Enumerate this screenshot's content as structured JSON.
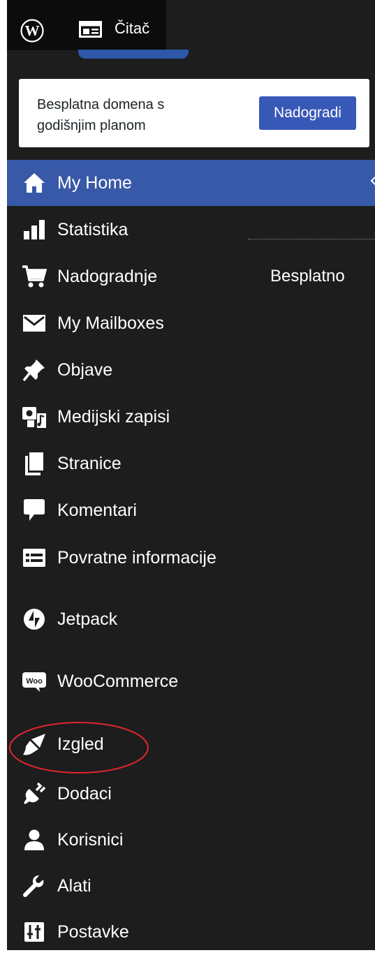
{
  "admin_bar": {
    "logo_icon": "wordpress-logo-icon",
    "reader_icon": "reader-icon",
    "reader_label": "Čitač"
  },
  "upgrade_card": {
    "text": "Besplatna domena s godišnjim planom",
    "button_label": "Nadogradi"
  },
  "menu": {
    "items": [
      {
        "label": "My Home",
        "icon": "home-icon",
        "active": true
      },
      {
        "label": "Statistika",
        "icon": "stats-icon"
      },
      {
        "label": "Nadogradnje",
        "icon": "cart-icon",
        "badge": "Besplatno"
      },
      {
        "label": "My Mailboxes",
        "icon": "mail-icon"
      },
      {
        "label": "Objave",
        "icon": "pin-icon"
      },
      {
        "label": "Medijski zapisi",
        "icon": "media-icon"
      },
      {
        "label": "Stranice",
        "icon": "pages-icon"
      },
      {
        "label": "Komentari",
        "icon": "comment-icon"
      },
      {
        "label": "Povratne informacije",
        "icon": "feedback-icon"
      },
      {
        "label": "Jetpack",
        "icon": "jetpack-icon"
      },
      {
        "label": "WooCommerce",
        "icon": "woocommerce-icon"
      },
      {
        "label": "Izgled",
        "icon": "brush-icon",
        "highlighted": true
      },
      {
        "label": "Dodaci",
        "icon": "plugin-icon"
      },
      {
        "label": "Korisnici",
        "icon": "user-icon"
      },
      {
        "label": "Alati",
        "icon": "wrench-icon"
      },
      {
        "label": "Postavke",
        "icon": "settings-icon"
      }
    ]
  },
  "colors": {
    "sidebar_bg": "#1d1d1e",
    "active_bg": "#3858a8",
    "button_bg": "#3858b8",
    "highlight_ellipse": "#e0262b"
  }
}
